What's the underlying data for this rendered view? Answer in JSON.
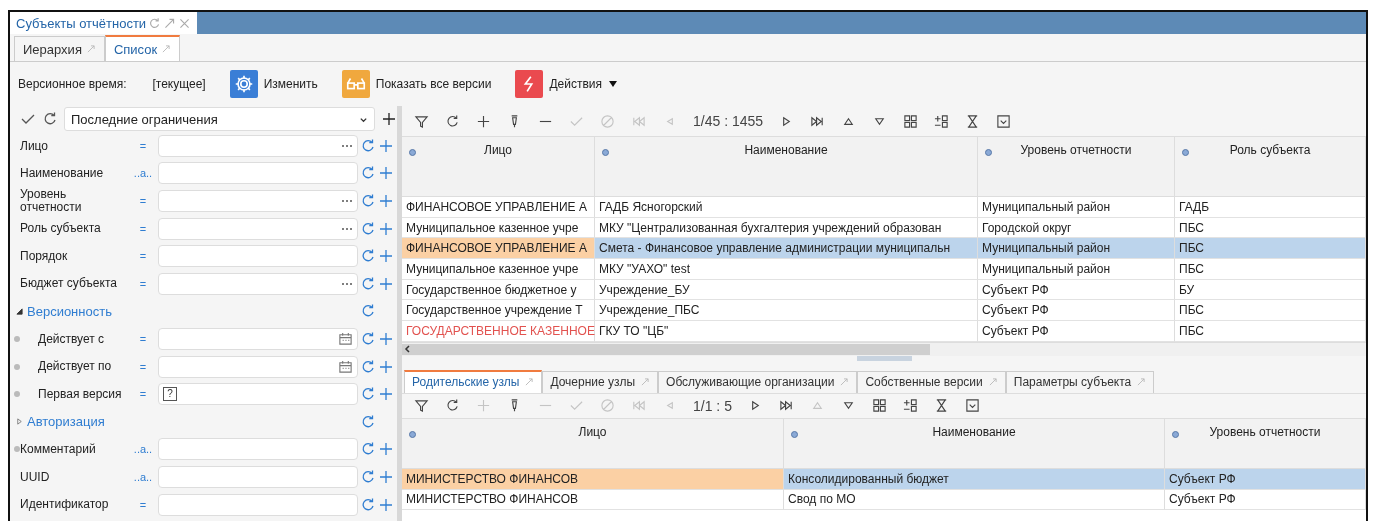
{
  "window": {
    "tab_title": "Субъекты отчётности"
  },
  "view_tabs": [
    {
      "label": "Иерархия",
      "selected": false
    },
    {
      "label": "Список",
      "selected": true
    }
  ],
  "toolbar": {
    "version_label": "Версионное время:",
    "version_value": "[текущее]",
    "buttons": [
      {
        "kind": "gear",
        "label": "Изменить",
        "dropdown": false
      },
      {
        "kind": "glasses",
        "label": "Показать все версии",
        "dropdown": false
      },
      {
        "kind": "lightning",
        "label": "Действия",
        "dropdown": true
      }
    ]
  },
  "filter_panel": {
    "preset": "Последние ограничения",
    "filters": [
      {
        "kind": "lookup",
        "label": "Лицо",
        "operator": "=",
        "marked": false
      },
      {
        "kind": "text",
        "label": "Наименование",
        "operator": "..a..",
        "marked": false
      },
      {
        "kind": "lookup",
        "label": "Уровень отчетности",
        "operator": "=",
        "marked": false
      },
      {
        "kind": "lookup",
        "label": "Роль субъекта",
        "operator": "=",
        "marked": false
      },
      {
        "kind": "text",
        "label": "Порядок",
        "operator": "=",
        "marked": false
      },
      {
        "kind": "lookup",
        "label": "Бюджет субъекта",
        "operator": "=",
        "marked": false
      },
      {
        "kind": "group",
        "label": "Версионность",
        "expanded": true,
        "children": [
          {
            "kind": "date",
            "label": "Действует с",
            "operator": "=",
            "marked": true
          },
          {
            "kind": "date",
            "label": "Действует по",
            "operator": "=",
            "marked": true
          },
          {
            "kind": "checkbox",
            "label": "Первая версия",
            "operator": "=",
            "value": "?",
            "indeterminate": true,
            "marked": true
          }
        ]
      },
      {
        "kind": "group",
        "label": "Авторизация",
        "expanded": false
      },
      {
        "kind": "text",
        "label": "Комментарий",
        "operator": "..a..",
        "marked": true
      },
      {
        "kind": "text",
        "label": "UUID",
        "operator": "..a..",
        "marked": false
      },
      {
        "kind": "text",
        "label": "Идентификатор",
        "operator": "=",
        "marked": false
      }
    ]
  },
  "grid": {
    "tools": [
      {
        "kind": "filter",
        "disabled": false
      },
      {
        "kind": "refresh",
        "disabled": false
      },
      {
        "kind": "add",
        "disabled": false
      },
      {
        "kind": "edit",
        "disabled": false
      },
      {
        "kind": "remove",
        "disabled": false
      },
      {
        "kind": "apply",
        "disabled": true
      },
      {
        "kind": "cancel",
        "disabled": true
      },
      {
        "kind": "first",
        "disabled": true
      },
      {
        "kind": "prev",
        "disabled": true
      },
      {
        "kind": "counter",
        "text": "1/45 : 1455"
      },
      {
        "kind": "next",
        "disabled": false
      },
      {
        "kind": "last",
        "disabled": false
      },
      {
        "kind": "up",
        "disabled": false
      },
      {
        "kind": "down",
        "disabled": false
      },
      {
        "kind": "grid",
        "disabled": false
      },
      {
        "kind": "gridadd",
        "disabled": false
      },
      {
        "kind": "clear",
        "disabled": false
      },
      {
        "kind": "menu",
        "disabled": false
      }
    ],
    "columns": [
      "Лицо",
      "Наименование",
      "Уровень отчетности",
      "Роль субъекта"
    ],
    "rows": [
      {
        "cells": [
          "ФИНАНСОВОЕ УПРАВЛЕНИЕ А",
          "ГАДБ Ясногорский",
          "Муниципальный район",
          "ГАДБ"
        ],
        "selected": false,
        "warning": false
      },
      {
        "cells": [
          "Муниципальное казенное учре",
          "МКУ \"Централизованная бухгалтерия учреждений образован",
          "Городской округ",
          "ПБС"
        ],
        "selected": false,
        "warning": false
      },
      {
        "cells": [
          "ФИНАНСОВОЕ УПРАВЛЕНИЕ А",
          "Смета - Финансовое управление администрации муниципальн",
          "Муниципальный район",
          "ПБС"
        ],
        "selected": true,
        "warning": false
      },
      {
        "cells": [
          "Муниципальное казенное учре",
          "МКУ \"УАХО\" test",
          "Муниципальный район",
          "ПБС"
        ],
        "selected": false,
        "warning": false
      },
      {
        "cells": [
          "Государственное бюджетное у",
          "Учреждение_БУ",
          "Субъект РФ",
          "БУ"
        ],
        "selected": false,
        "warning": false
      },
      {
        "cells": [
          "Государственное учреждение Т",
          "Учреждение_ПБС",
          "Субъект РФ",
          "ПБС"
        ],
        "selected": false,
        "warning": false
      },
      {
        "cells": [
          "ГОСУДАРСТВЕННОЕ КАЗЕННОЕ",
          "ГКУ ТО \"ЦБ\"",
          "Субъект РФ",
          "ПБС"
        ],
        "selected": false,
        "warning": true
      }
    ]
  },
  "detail_tabs": [
    {
      "label": "Родительские узлы",
      "selected": true
    },
    {
      "label": "Дочерние узлы",
      "selected": false
    },
    {
      "label": "Обслуживающие организации",
      "selected": false
    },
    {
      "label": "Собственные версии",
      "selected": false
    },
    {
      "label": "Параметры субъекта",
      "selected": false
    }
  ],
  "detail_grid": {
    "tools": [
      {
        "kind": "filter",
        "disabled": false
      },
      {
        "kind": "refresh",
        "disabled": false
      },
      {
        "kind": "add",
        "disabled": true
      },
      {
        "kind": "edit",
        "disabled": false
      },
      {
        "kind": "remove",
        "disabled": true
      },
      {
        "kind": "apply",
        "disabled": true
      },
      {
        "kind": "cancel",
        "disabled": true
      },
      {
        "kind": "first",
        "disabled": true
      },
      {
        "kind": "prev",
        "disabled": true
      },
      {
        "kind": "counter",
        "text": "1/1 : 5"
      },
      {
        "kind": "next",
        "disabled": false
      },
      {
        "kind": "last",
        "disabled": false
      },
      {
        "kind": "up",
        "disabled": true
      },
      {
        "kind": "down",
        "disabled": false
      },
      {
        "kind": "grid",
        "disabled": false
      },
      {
        "kind": "gridadd",
        "disabled": false
      },
      {
        "kind": "clear",
        "disabled": false
      },
      {
        "kind": "menu",
        "disabled": false
      }
    ],
    "columns": [
      "Лицо",
      "Наименование",
      "Уровень отчетности"
    ],
    "rows": [
      {
        "cells": [
          "МИНИСТЕРСТВО ФИНАНСОВ",
          "Консолидированный бюджет",
          "Субъект РФ"
        ],
        "selected": true,
        "warning": false
      },
      {
        "cells": [
          "МИНИСТЕРСТВО ФИНАНСОВ",
          "Свод по МО",
          "Субъект РФ"
        ],
        "selected": false,
        "warning": false
      }
    ]
  }
}
